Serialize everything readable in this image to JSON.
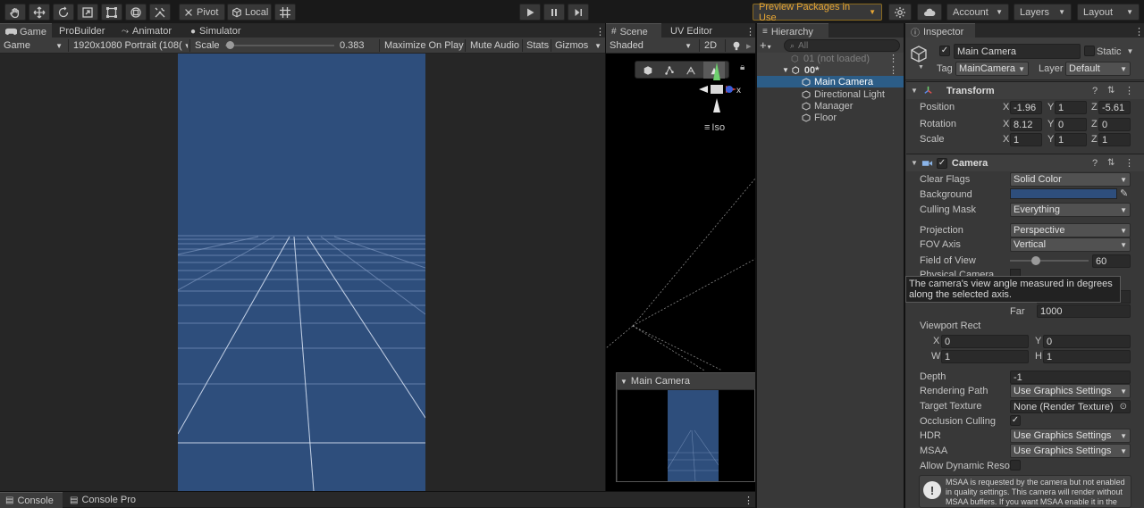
{
  "toolbar": {
    "pivot_label": "Pivot",
    "local_label": "Local",
    "preview_packages_label": "Preview Packages in Use",
    "account_label": "Account",
    "layers_label": "Layers",
    "layout_label": "Layout"
  },
  "game_panel": {
    "tabs": [
      {
        "label": "Game"
      },
      {
        "label": "ProBuilder"
      },
      {
        "label": "Animator"
      },
      {
        "label": "Simulator"
      }
    ],
    "display_dropdown": "Game",
    "resolution_dropdown": "1920x1080 Portrait (108(",
    "scale_label": "Scale",
    "scale_value": "0.383",
    "scale_fraction": 0.04,
    "maximize_on_play": "Maximize On Play",
    "mute_audio": "Mute Audio",
    "stats": "Stats",
    "gizmos": "Gizmos"
  },
  "scene_panel": {
    "tabs": [
      {
        "label": "Scene"
      },
      {
        "label": "UV Editor"
      }
    ],
    "shading_dropdown": "Shaded",
    "mode_2d": "2D",
    "iso_label": "Iso",
    "gizmo_x_label": "x",
    "camera_preview_title": "Main Camera"
  },
  "hierarchy": {
    "tab_label": "Hierarchy",
    "search_placeholder": "All",
    "items": [
      {
        "label": "01 (not loaded)"
      },
      {
        "label": "00*"
      },
      {
        "label": "Main Camera"
      },
      {
        "label": "Directional Light"
      },
      {
        "label": "Manager"
      },
      {
        "label": "Floor"
      }
    ]
  },
  "inspector": {
    "tab_label": "Inspector",
    "object_name": "Main Camera",
    "static_label": "Static",
    "tag_label": "Tag",
    "tag_value": "MainCamera",
    "layer_label": "Layer",
    "layer_value": "Default",
    "transform": {
      "title": "Transform",
      "position_label": "Position",
      "rotation_label": "Rotation",
      "scale_label": "Scale",
      "axis_x": "X",
      "axis_y": "Y",
      "axis_z": "Z",
      "position": {
        "x": "-1.96",
        "y": "1",
        "z": "-5.61"
      },
      "rotation": {
        "x": "8.12",
        "y": "0",
        "z": "0"
      },
      "scale": {
        "x": "1",
        "y": "1",
        "z": "1"
      }
    },
    "camera": {
      "title": "Camera",
      "clear_flags_label": "Clear Flags",
      "clear_flags_value": "Solid Color",
      "background_label": "Background",
      "background_color": "#2e4e7c",
      "culling_mask_label": "Culling Mask",
      "culling_mask_value": "Everything",
      "projection_label": "Projection",
      "projection_value": "Perspective",
      "fov_axis_label": "FOV Axis",
      "fov_axis_value": "Vertical",
      "fov_label": "Field of View",
      "fov_value": "60",
      "fov_fraction": 0.33,
      "physical_camera_label": "Physical Camera",
      "tooltip": "The camera's view angle measured in degrees along the selected axis.",
      "far_label": "Far",
      "far_value": "1000",
      "viewport_rect_label": "Viewport Rect",
      "vp_x_label": "X",
      "vp_x": "0",
      "vp_y_label": "Y",
      "vp_y": "0",
      "vp_w_label": "W",
      "vp_w": "1",
      "vp_h_label": "H",
      "vp_h": "1",
      "depth_label": "Depth",
      "depth_value": "-1",
      "rendering_path_label": "Rendering Path",
      "rendering_path_value": "Use Graphics Settings",
      "target_texture_label": "Target Texture",
      "target_texture_value": "None (Render Texture)",
      "occlusion_culling_label": "Occlusion Culling",
      "hdr_label": "HDR",
      "hdr_value": "Use Graphics Settings",
      "msaa_label": "MSAA",
      "msaa_value": "Use Graphics Settings",
      "allow_dynamic_label": "Allow Dynamic Reso",
      "msaa_info": "MSAA is requested by the camera but not enabled in quality settings. This camera will render without MSAA buffers. If you want MSAA enable it in the quality settings."
    }
  },
  "console": {
    "tabs": [
      {
        "label": "Console"
      },
      {
        "label": "Console Pro"
      }
    ]
  },
  "colors": {
    "game_view_blue": "#2e4e7c",
    "selection_blue": "#2c5d87",
    "accent_orange": "#e8a735"
  }
}
